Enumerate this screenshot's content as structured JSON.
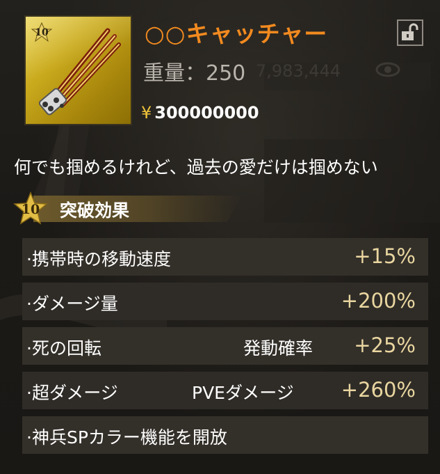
{
  "item": {
    "level": "10",
    "name": "○○キャッチャー",
    "weight_label": "重量：",
    "weight_value": "250",
    "price_symbol": "¥",
    "price": "300000000",
    "flavor_text": "何でも掴めるけれど、過去の愛だけは掴めない"
  },
  "lock_icon": "unlocked-padlock-icon",
  "background_text": {
    "number": "7,983,444",
    "eye_icon": "eye-icon"
  },
  "breakthrough": {
    "level": "10",
    "title": "突破効果",
    "effects": [
      {
        "label": "·携帯時の移動速度",
        "condition": "",
        "value": "+15%"
      },
      {
        "label": "·ダメージ量",
        "condition": "",
        "value": "+200%"
      },
      {
        "label": "·死の回転",
        "condition": "発動確率",
        "value": "+25%"
      },
      {
        "label": "·超ダメージ",
        "condition": "PVEダメージ",
        "value": "+260%"
      },
      {
        "label": "·神兵SPカラー機能を開放",
        "condition": "",
        "value": ""
      }
    ]
  },
  "colors": {
    "title": "#f28a1f",
    "value": "#e9d6a0",
    "gold_frame": "#c9a91c",
    "yen": "#f0c43a"
  }
}
